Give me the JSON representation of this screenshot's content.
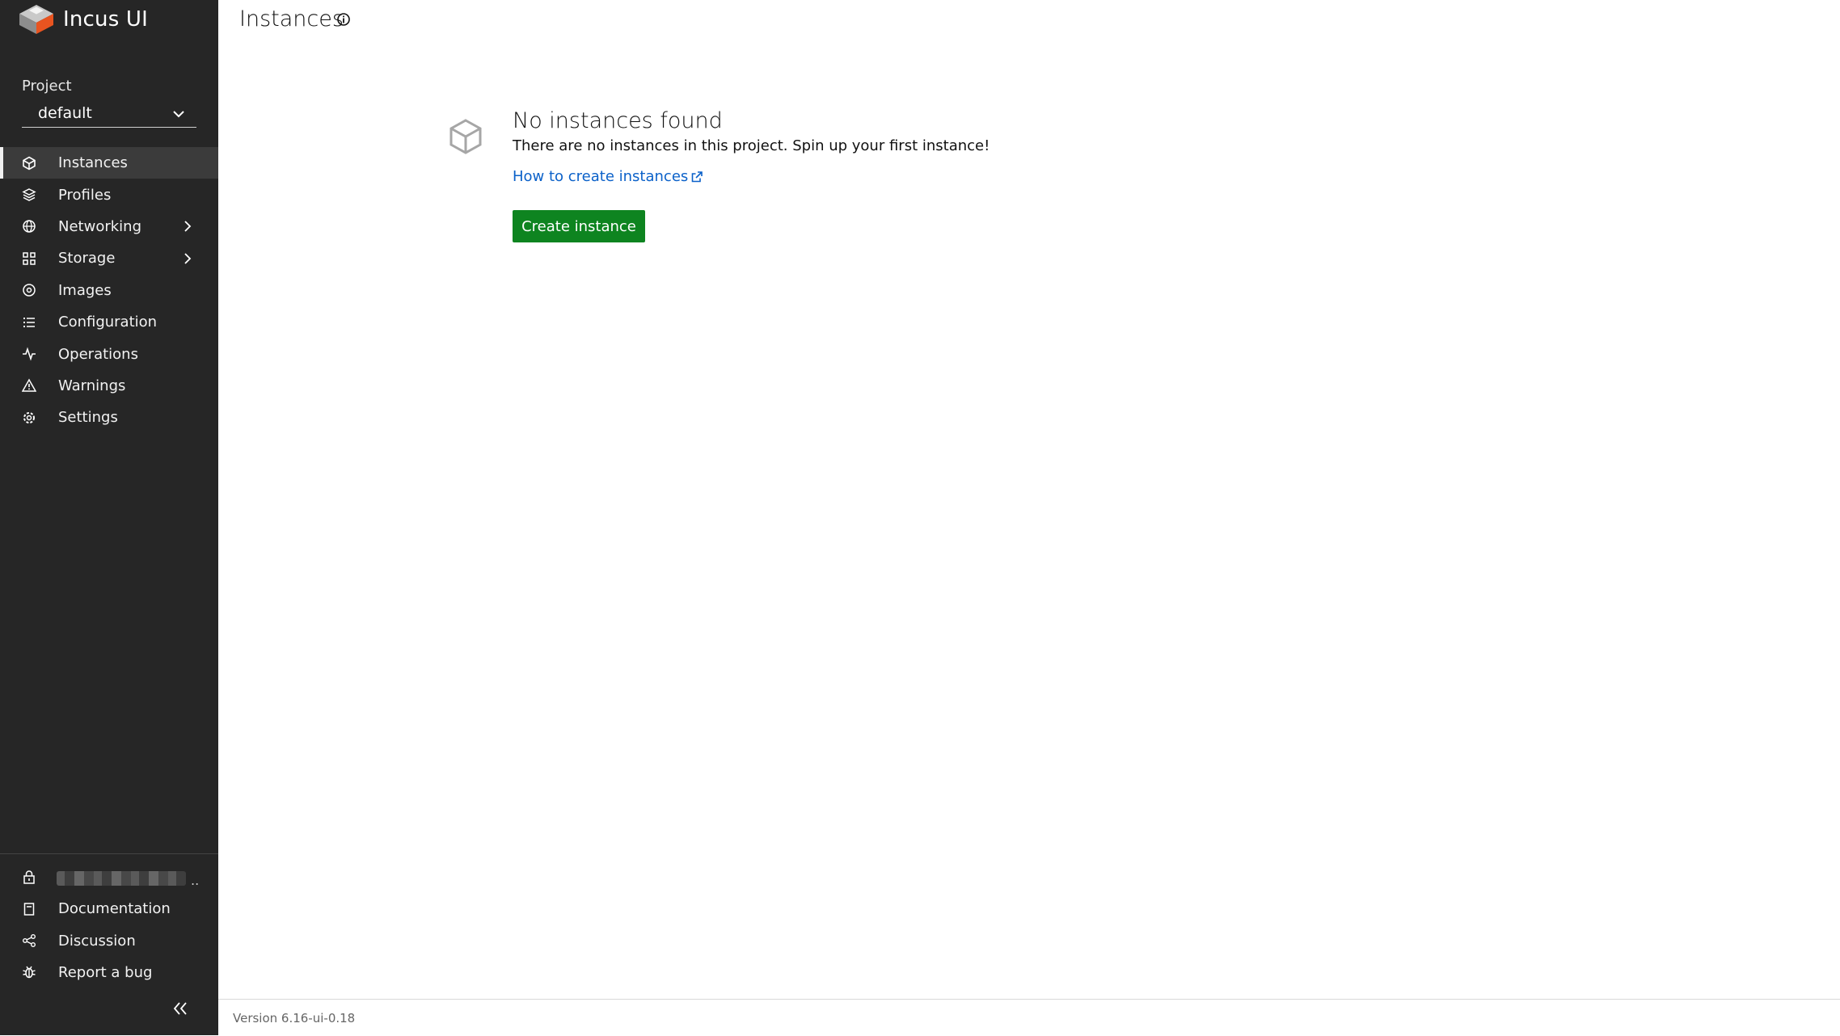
{
  "app": {
    "title": "Incus UI"
  },
  "project": {
    "label": "Project",
    "selected": "default"
  },
  "nav": [
    {
      "label": "Instances",
      "icon": "instances-icon",
      "active": true
    },
    {
      "label": "Profiles",
      "icon": "profiles-icon"
    },
    {
      "label": "Networking",
      "icon": "networking-icon",
      "expandable": true
    },
    {
      "label": "Storage",
      "icon": "storage-icon",
      "expandable": true
    },
    {
      "label": "Images",
      "icon": "images-icon"
    },
    {
      "label": "Configuration",
      "icon": "configuration-icon"
    },
    {
      "label": "Operations",
      "icon": "operations-icon"
    },
    {
      "label": "Warnings",
      "icon": "warning-icon"
    },
    {
      "label": "Settings",
      "icon": "settings-icon"
    }
  ],
  "footer_nav": [
    {
      "label": "Documentation",
      "icon": "documentation-icon"
    },
    {
      "label": "Discussion",
      "icon": "share-icon"
    },
    {
      "label": "Report a bug",
      "icon": "bug-icon"
    }
  ],
  "page": {
    "title": "Instances",
    "empty_title": "No instances found",
    "empty_desc": "There are no instances in this project. Spin up your first instance!",
    "link_label": "How to create instances",
    "create_label": "Create instance"
  },
  "version": "Version 6.16-ui-0.18",
  "colors": {
    "sidebar": "#262626",
    "active_item": "#3b3b3b",
    "primary_button": "#0e8420",
    "link": "#0b61c9"
  }
}
